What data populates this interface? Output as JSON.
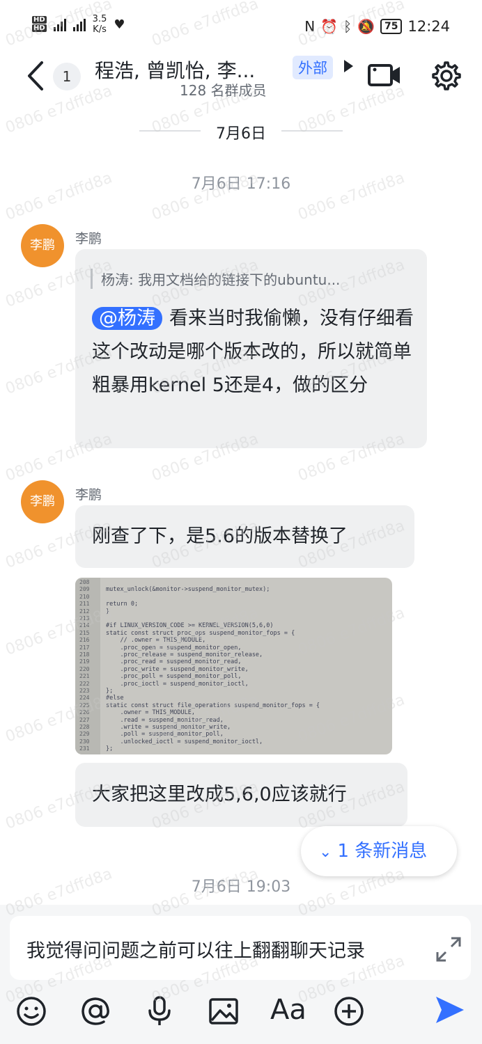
{
  "status_bar": {
    "network": [
      "HD",
      "HD"
    ],
    "speed_value": "3.5",
    "speed_unit": "K/s",
    "battery": "75",
    "time": "12:24"
  },
  "header": {
    "unread_count": "1",
    "title": "程浩, 曾凯怡, 李...",
    "members": "128 名群成员",
    "external_tag": "外部"
  },
  "date_divider": "7月6日",
  "messages": [
    {
      "timestamp": "7月6日 17:16",
      "sender": "李鹏",
      "avatar_text": "李鹏",
      "quote": "杨涛: 我用文档给的链接下的ubuntu...",
      "mention": "@杨涛",
      "text": "看来当时我偷懒，没有仔细看这个改动是哪个版本改的，所以就简单粗暴用kernel 5还是4，做的区分"
    },
    {
      "sender": "李鹏",
      "avatar_text": "李鹏",
      "text": "刚查了下，是5.6的版本替换了"
    },
    {
      "text": "大家把这里改成5,6,0应该就行"
    }
  ],
  "code_image": {
    "line_numbers": [
      "208",
      "209",
      "210",
      "211",
      "212",
      "213",
      "214",
      "215",
      "216",
      "217",
      "218",
      "219",
      "220",
      "221",
      "222",
      "223",
      "224",
      "225",
      "226",
      "227",
      "228",
      "229",
      "230",
      "231"
    ],
    "lines": [
      "",
      "mutex_unlock(&monitor->suspend_monitor_mutex);",
      "",
      "return 0;",
      "}",
      "",
      "#if LINUX_VERSION_CODE >= KERNEL_VERSION(5,6,0)",
      "static const struct proc_ops suspend_monitor_fops = {",
      "    // .owner = THIS_MODULE,",
      "    .proc_open = suspend_monitor_open,",
      "    .proc_release = suspend_monitor_release,",
      "    .proc_read = suspend_monitor_read,",
      "    .proc_write = suspend_monitor_write,",
      "    .proc_poll = suspend_monitor_poll,",
      "    .proc_ioctl = suspend_monitor_ioctl,",
      "};",
      "#else",
      "static const struct file_operations suspend_monitor_fops = {",
      "    .owner = THIS_MODULE,",
      "    .read = suspend_monitor_read,",
      "    .write = suspend_monitor_write,",
      "    .poll = suspend_monitor_poll,",
      "    .unlocked_ioctl = suspend_monitor_ioctl,",
      "};"
    ]
  },
  "new_message_pill": "1 条新消息",
  "second_timestamp": "7月6日 19:03",
  "input": {
    "value": "我觉得问问题之前可以往上翻翻聊天记录"
  },
  "toolbar": {
    "icons": [
      "emoji-icon",
      "mention-icon",
      "microphone-icon",
      "image-icon",
      "font-format-icon",
      "add-icon",
      "send-icon"
    ],
    "font_label": "Aa"
  },
  "watermark": "0806 e7dffd8a",
  "colors": {
    "accent": "#3370ff",
    "avatar": "#f0922d",
    "bubble": "#eff0f1"
  }
}
